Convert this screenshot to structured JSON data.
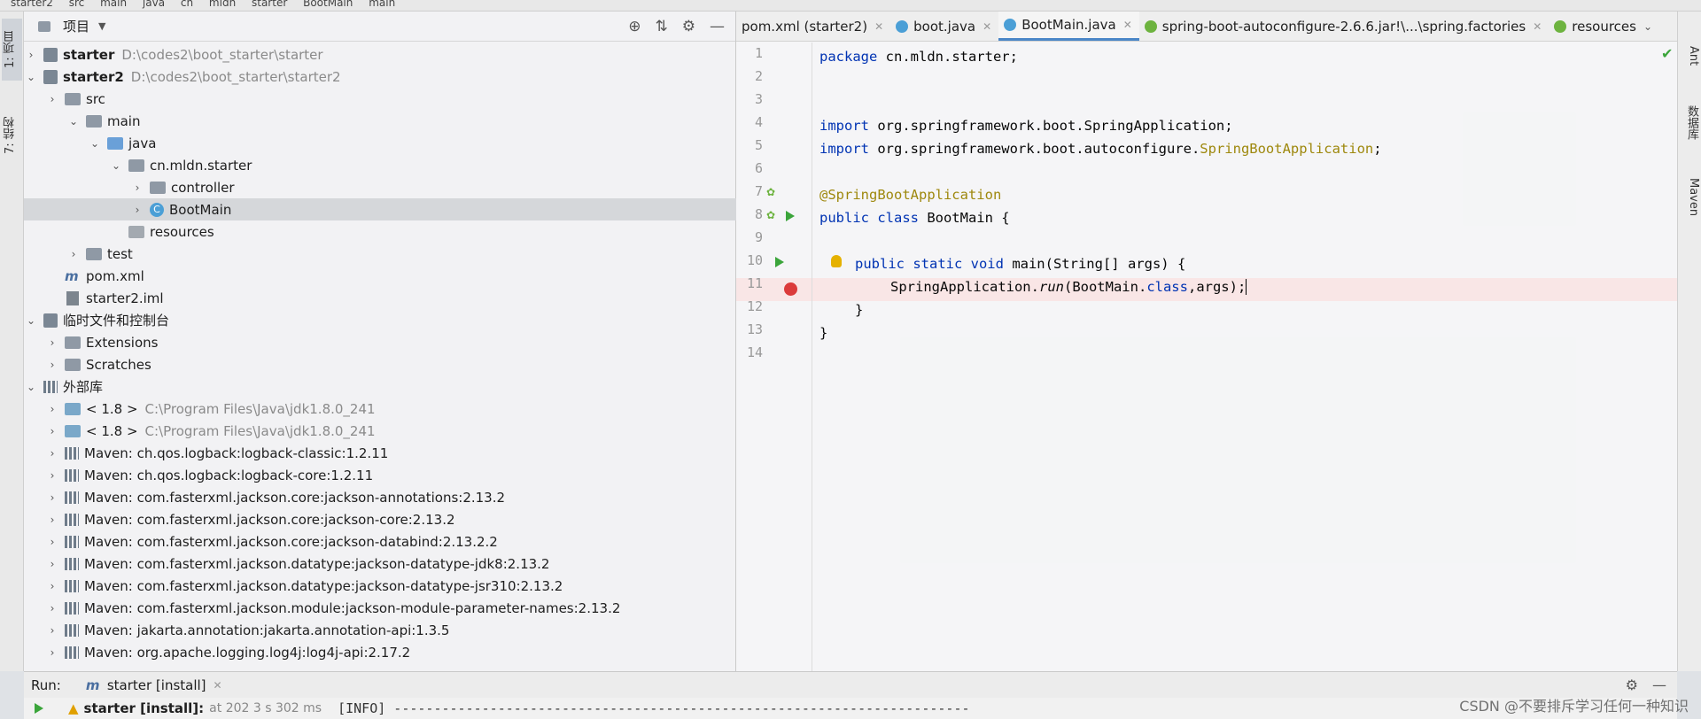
{
  "topbar": {
    "crumbs": [
      "starter2",
      "src",
      "main",
      "java",
      "cn",
      "mldn",
      "starter",
      "BootMain",
      "main"
    ]
  },
  "left_strip": {
    "tab_project": "1: 项目",
    "tab_structure": "7: 结构"
  },
  "right_strip": {
    "tab_ant": "Ant",
    "tab_database": "数据库",
    "tab_maven": "Maven"
  },
  "project": {
    "title": "项目",
    "tree": [
      {
        "label": "starter",
        "path": "D:\\codes2\\boot_starter\\starter",
        "bold": true
      },
      {
        "label": "starter2",
        "path": "D:\\codes2\\boot_starter\\starter2",
        "bold": true
      },
      {
        "label": "src"
      },
      {
        "label": "main"
      },
      {
        "label": "java"
      },
      {
        "label": "cn.mldn.starter"
      },
      {
        "label": "controller"
      },
      {
        "label": "BootMain"
      },
      {
        "label": "resources"
      },
      {
        "label": "test"
      },
      {
        "label": "pom.xml"
      },
      {
        "label": "starter2.iml"
      },
      {
        "label": "临时文件和控制台"
      },
      {
        "label": "Extensions"
      },
      {
        "label": "Scratches"
      },
      {
        "label": "外部库"
      },
      {
        "label": "< 1.8 >",
        "path": "C:\\Program Files\\Java\\jdk1.8.0_241"
      },
      {
        "label": "< 1.8 >",
        "path": "C:\\Program Files\\Java\\jdk1.8.0_241"
      },
      {
        "label": "Maven: ch.qos.logback:logback-classic:1.2.11"
      },
      {
        "label": "Maven: ch.qos.logback:logback-core:1.2.11"
      },
      {
        "label": "Maven: com.fasterxml.jackson.core:jackson-annotations:2.13.2"
      },
      {
        "label": "Maven: com.fasterxml.jackson.core:jackson-core:2.13.2"
      },
      {
        "label": "Maven: com.fasterxml.jackson.core:jackson-databind:2.13.2.2"
      },
      {
        "label": "Maven: com.fasterxml.jackson.datatype:jackson-datatype-jdk8:2.13.2"
      },
      {
        "label": "Maven: com.fasterxml.jackson.datatype:jackson-datatype-jsr310:2.13.2"
      },
      {
        "label": "Maven: com.fasterxml.jackson.module:jackson-module-parameter-names:2.13.2"
      },
      {
        "label": "Maven: jakarta.annotation:jakarta.annotation-api:1.3.5"
      },
      {
        "label": "Maven: org.apache.logging.log4j:log4j-api:2.17.2"
      }
    ]
  },
  "editor": {
    "tabs": [
      "pom.xml (starter2)",
      "boot.java",
      "BootMain.java",
      "spring-boot-autoconfigure-2.6.6.jar!\\...\\spring.factories",
      "resources"
    ],
    "active_tab": "BootMain.java",
    "line_numbers": [
      "1",
      "2",
      "3",
      "4",
      "5",
      "6",
      "7",
      "8",
      "9",
      "10",
      "11",
      "12",
      "13",
      "14"
    ],
    "code": {
      "l1_kw": "package",
      "l1_rest": " cn.mldn.starter;",
      "l4_kw": "import",
      "l4_rest": " org.springframework.boot.SpringApplication;",
      "l5_kw": "import",
      "l5_rest": " org.springframework.boot.autoconfigure.",
      "l5_ann": "SpringBootApplication",
      "l5_end": ";",
      "l7_ann": "@SpringBootApplication",
      "l8_kw": "public class",
      "l8_rest": " BootMain {",
      "l10_kw": "public static void",
      "l10_rest": " main(String[] args) {",
      "l11_a": "SpringApplication.",
      "l11_run": "run",
      "l11_b": "(BootMain.",
      "l11_kw": "class",
      "l11_c": ",args);",
      "l12": "}",
      "l13": "}"
    }
  },
  "runbar": {
    "label": "Run:",
    "tab": "starter [install]"
  },
  "console": {
    "job": "starter [install]:",
    "time": "at 202 3 s 302 ms",
    "output": "[INFO] ------------------------------------------------------------------------"
  },
  "watermark": "CSDN @不要排斥学习任何一种知识"
}
